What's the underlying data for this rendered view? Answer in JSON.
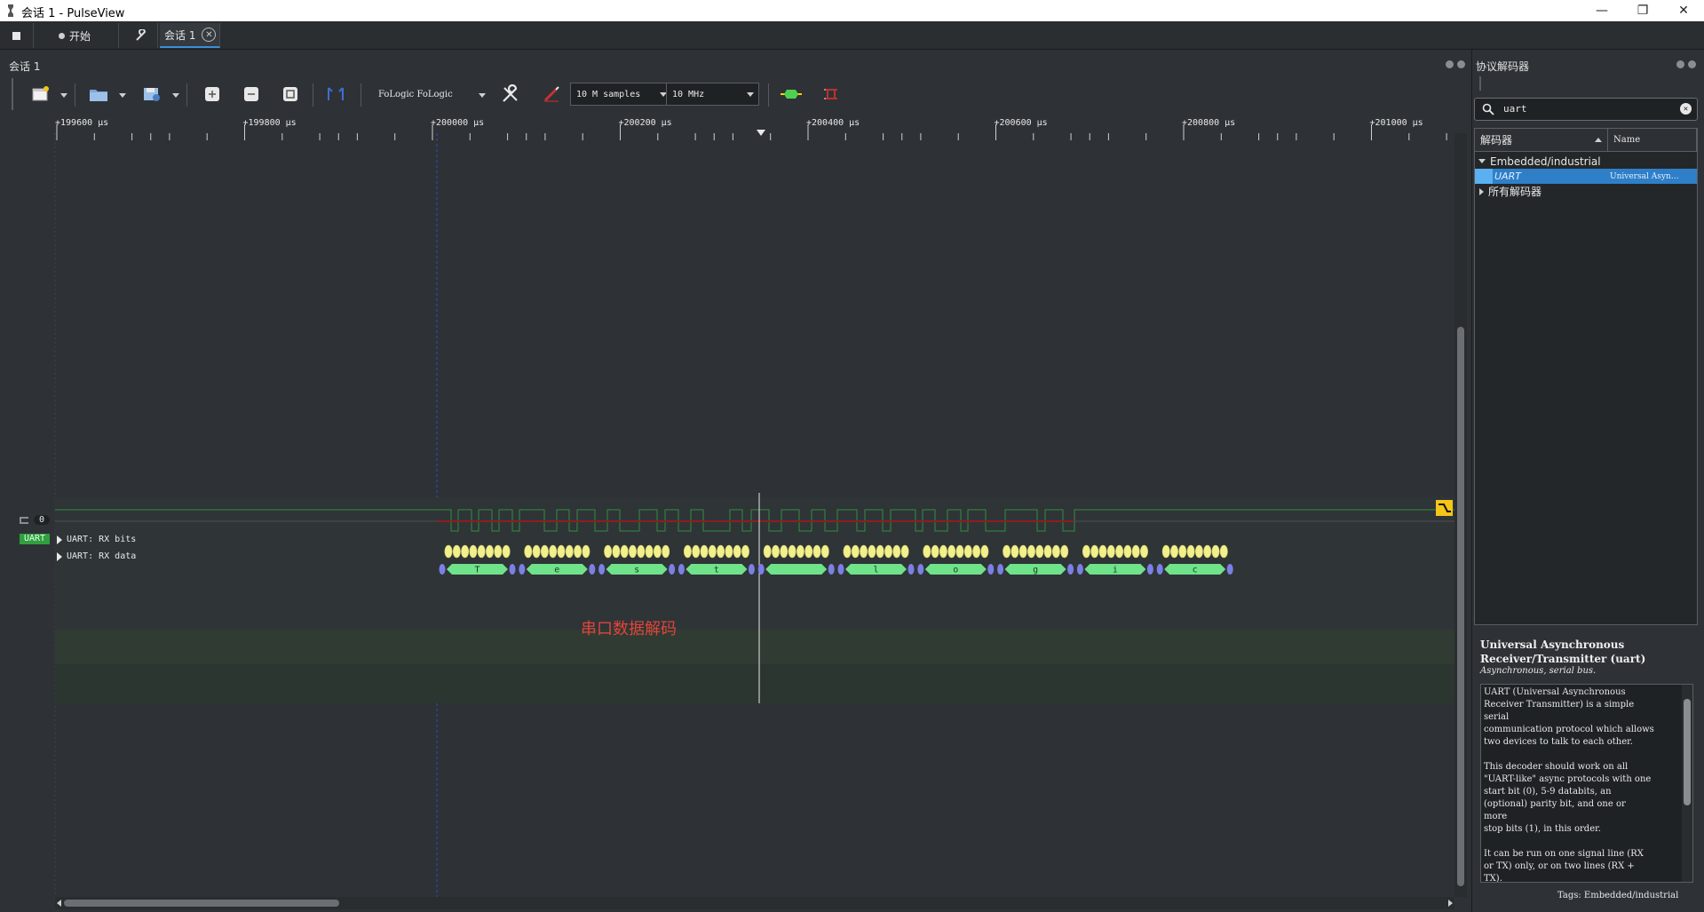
{
  "window": {
    "title": "会话 1 - PulseView",
    "minimize": "—",
    "restore": "❐",
    "close": "✕"
  },
  "tabs": [
    {
      "label": "开始"
    },
    {
      "label": "会话 1"
    }
  ],
  "session_panel": {
    "title": "会话 1"
  },
  "toolbar": {
    "device": "FoLogic FoLogic",
    "samples": "10 M samples",
    "samplerate": "10 MHz"
  },
  "ruler": {
    "ticks": [
      "+199600 µs",
      "+199800 µs",
      "+200000 µs",
      "+200200 µs",
      "+200400 µs",
      "+200600 µs",
      "+200800 µs",
      "+201000 µs"
    ]
  },
  "channel": {
    "number": "0"
  },
  "decoder_rows": {
    "badge": "UART",
    "rx_bits": "UART: RX bits",
    "rx_data": "UART: RX data"
  },
  "decoded_chars": [
    "T",
    "e",
    "s",
    "t",
    "",
    "l",
    "o",
    "g",
    "i",
    "c"
  ],
  "frame_markers": [
    "S",
    "P",
    "S",
    "P",
    "S",
    "P",
    "S",
    "P",
    "S",
    "P",
    "S",
    "P",
    "S",
    "P",
    "S",
    "P",
    "S",
    "P",
    "S",
    "P"
  ],
  "annotation": "串口数据解码",
  "decoder_panel": {
    "title": "协议解码器",
    "search_value": "uart",
    "col_decoder": "解码器",
    "col_name": "Name",
    "category": "Embedded/industrial",
    "item_id": "UART",
    "item_name": "Universal Asyn…",
    "all_decoders": "所有解码器",
    "desc_title": "Universal Asynchronous Receiver/Transmitter (uart)",
    "desc_subtitle": "Asynchronous, serial bus.",
    "desc_text": "UART (Universal Asynchronous\nReceiver Transmitter) is a simple\nserial\ncommunication protocol which allows\ntwo devices to talk to each other.\n\nThis decoder should work on all\n\"UART-like\" async protocols with one\nstart bit (0), 5-9 databits, an\n(optional) parity bit, and one or\nmore\nstop bits (1), in this order.\n\nIt can be run on one signal line (RX\nor TX) only, or on two lines (RX +\nTX).",
    "tags": "Tags: Embedded/industrial"
  },
  "colors": {
    "background": "#2e3236",
    "signal_green": "#3fbf3f",
    "bits_yellow": "#f2f08a",
    "data_green": "#6fe28a",
    "marker_blue": "#7b7fe6",
    "cursor_blue": "#3050c0",
    "accent_blue": "#3b8fd6",
    "annotation_red": "#e0453a"
  }
}
